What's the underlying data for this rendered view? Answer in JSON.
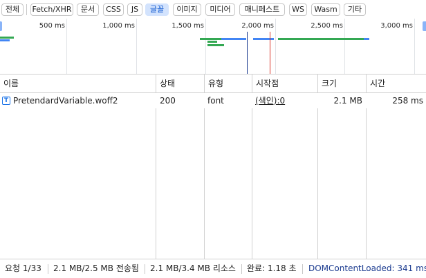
{
  "filters": {
    "all": "전체",
    "fetch_xhr": "Fetch/XHR",
    "doc": "문서",
    "css": "CSS",
    "js": "JS",
    "font": "글꼴",
    "img": "이미지",
    "media": "미디어",
    "manifest": "매니페스트",
    "ws": "WS",
    "wasm": "Wasm",
    "other": "기타",
    "active": "font"
  },
  "overview": {
    "ticks": [
      "500 ms",
      "1,000 ms",
      "1,500 ms",
      "2,000 ms",
      "2,500 ms",
      "3,000 ms"
    ],
    "colors": {
      "grid": "#e0e3e7",
      "dom_content_loaded": "#1a3a8f",
      "load": "#d93025",
      "bar_green": "#34a853",
      "bar_blue": "#4285f4"
    }
  },
  "table": {
    "headers": {
      "name": "이름",
      "status": "상태",
      "type": "유형",
      "initiator": "시작점",
      "size": "크기",
      "time": "시간"
    },
    "rows": [
      {
        "icon": "font-file-icon",
        "icon_glyph": "T",
        "name": "PretendardVariable.woff2",
        "status": "200",
        "type": "font",
        "initiator": "(색인):0",
        "size": "2.1 MB",
        "time": "258 ms"
      }
    ]
  },
  "statusbar": {
    "requests": "요청 1/33",
    "transferred": "2.1 MB/2.5 MB 전송됨",
    "resources": "2.1 MB/3.4 MB 리소스",
    "finish": "완료: 1.18 초",
    "dom_content_loaded": "DOMContentLoaded: 341 ms",
    "dom_color": "#1a3a8f"
  }
}
